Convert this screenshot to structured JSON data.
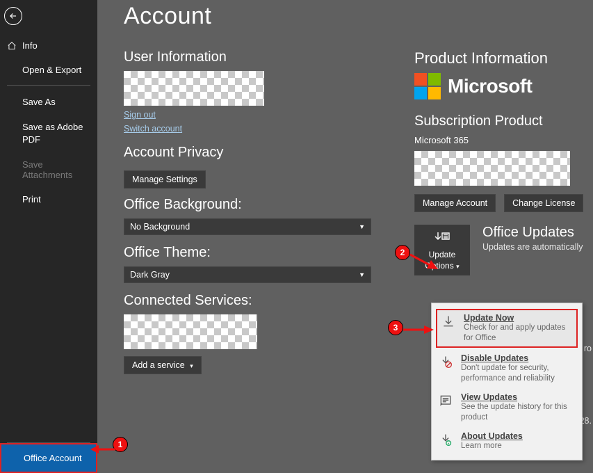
{
  "sidebar": {
    "info": "Info",
    "open_export": "Open & Export",
    "save_as": "Save As",
    "save_adobe": "Save as Adobe PDF",
    "save_attachments": "Save Attachments",
    "print": "Print",
    "office_account": "Office Account"
  },
  "page_title": "Account",
  "user_info": {
    "heading": "User Information",
    "sign_out": "Sign out",
    "switch": "Switch account"
  },
  "privacy": {
    "heading": "Account Privacy",
    "manage": "Manage Settings"
  },
  "background": {
    "heading": "Office Background:",
    "value": "No Background"
  },
  "theme": {
    "heading": "Office Theme:",
    "value": "Dark Gray"
  },
  "connected": {
    "heading": "Connected Services:",
    "add": "Add a service"
  },
  "product": {
    "heading": "Product Information",
    "brand": "Microsoft",
    "sub_heading": "Subscription Product",
    "sub_name": "Microsoft 365",
    "manage": "Manage Account",
    "change": "Change License"
  },
  "updates": {
    "btn_line1": "Update",
    "btn_line2": "Options",
    "title": "Office Updates",
    "subtitle": "Updates are automatically"
  },
  "menu": {
    "update_now": {
      "title": "Update Now",
      "desc": "Check for and apply updates for Office"
    },
    "disable": {
      "title": "Disable Updates",
      "desc": "Don't update for security, performance and reliability"
    },
    "view": {
      "title": "View Updates",
      "desc": "See the update history for this product"
    },
    "about": {
      "title": "About Updates",
      "desc": "Learn more"
    }
  },
  "trunc": {
    "a": "ro",
    "b": "28."
  },
  "badges": {
    "one": "1",
    "two": "2",
    "three": "3"
  }
}
